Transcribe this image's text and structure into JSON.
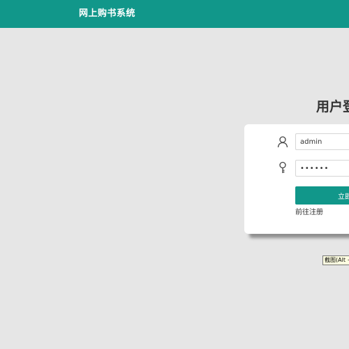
{
  "app": {
    "title": "网上购书系统"
  },
  "colors": {
    "primary": "#11978a",
    "background": "#e6e6e6",
    "card": "#ffffff",
    "tooltip_bg": "#ffffe1"
  },
  "login": {
    "title": "用户登",
    "username": {
      "value": "admin",
      "icon": "user-icon"
    },
    "password": {
      "value": "••••••",
      "icon": "key-icon"
    },
    "submit_label": "立即",
    "register_link": "前往注册"
  },
  "tooltip": {
    "text": "截图(Alt +"
  }
}
